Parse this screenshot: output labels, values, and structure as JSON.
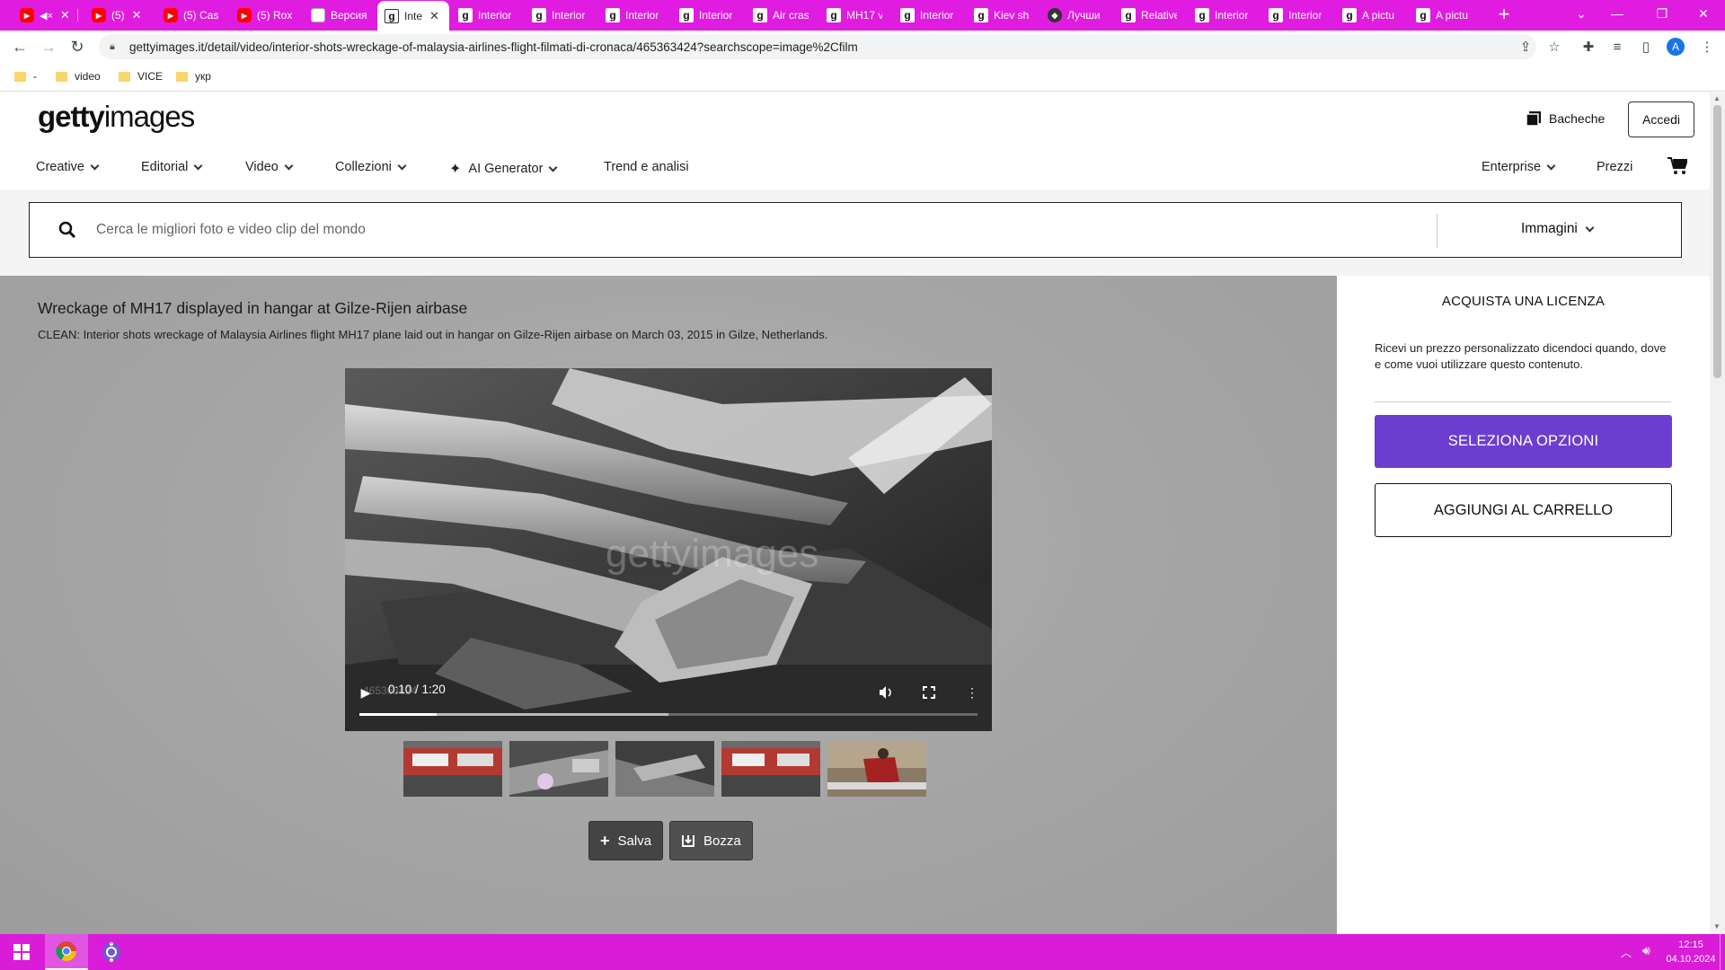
{
  "browser": {
    "tabs": [
      {
        "title": "",
        "icon": "youtube",
        "muted": true
      },
      {
        "title": "(5)",
        "icon": "youtube"
      },
      {
        "title": "(5) Cas",
        "icon": "youtube"
      },
      {
        "title": "(5) Rox",
        "icon": "youtube"
      },
      {
        "title": "Версия",
        "icon": "doc"
      },
      {
        "title": "Inte",
        "icon": "getty",
        "active": true
      },
      {
        "title": "Interior",
        "icon": "getty"
      },
      {
        "title": "Interior",
        "icon": "getty"
      },
      {
        "title": "Interior",
        "icon": "getty"
      },
      {
        "title": "Interior",
        "icon": "getty"
      },
      {
        "title": "Air cras",
        "icon": "getty"
      },
      {
        "title": "MH17 v",
        "icon": "getty"
      },
      {
        "title": "Interior",
        "icon": "getty"
      },
      {
        "title": "Kiev sh",
        "icon": "getty"
      },
      {
        "title": "Лучши",
        "icon": "cube"
      },
      {
        "title": "Relative",
        "icon": "getty"
      },
      {
        "title": "Interior",
        "icon": "getty"
      },
      {
        "title": "Interior",
        "icon": "getty"
      },
      {
        "title": "A pictu",
        "icon": "getty"
      },
      {
        "title": "A pictu",
        "icon": "getty"
      }
    ],
    "new_tab": "+",
    "url": "gettyimages.it/detail/video/interior-shots-wreckage-of-malaysia-airlines-flight-filmati-di-cronaca/465363424?searchscope=image%2Cfilm",
    "profile_initial": "A",
    "bookmarks": [
      {
        "label": "-"
      },
      {
        "label": "video"
      },
      {
        "label": "VICE"
      },
      {
        "label": "укр"
      }
    ]
  },
  "site": {
    "logo_bold": "getty",
    "logo_light": "images",
    "boards_label": "Bacheche",
    "login_label": "Accedi",
    "menu": [
      {
        "label": "Creative"
      },
      {
        "label": "Editorial"
      },
      {
        "label": "Video"
      },
      {
        "label": "Collezioni"
      },
      {
        "label": "AI Generator"
      },
      {
        "label": "Trend e analisi"
      }
    ],
    "enterprise_label": "Enterprise",
    "pricing_label": "Prezzi",
    "search_placeholder": "Cerca le migliori foto e video clip del mondo",
    "search_scope": "Immagini"
  },
  "asset": {
    "title": "Wreckage of MH17 displayed in hangar at Gilze-Rijen airbase",
    "caption": "CLEAN: Interior shots wreckage of Malaysia Airlines flight MH17 plane laid out in hangar on Gilze-Rijen airbase on March 03, 2015 in Gilze, Netherlands.",
    "watermark": "gettyimages",
    "video_id": "465363424",
    "time_display": "0:10 / 1:20",
    "progress_played": 0.125,
    "progress_buffered": 0.5,
    "save_label": "Salva",
    "draft_label": "Bozza"
  },
  "license": {
    "title": "ACQUISTA UNA LICENZA",
    "text": "Ricevi un prezzo personalizzato dicendoci quando, dove e come vuoi utilizzare questo contenuto.",
    "options_button": "SELEZIONA OPZIONI",
    "cart_button": "AGGIUNGI AL CARRELLO"
  },
  "taskbar": {
    "time": "12:15",
    "date": "04.10.2024"
  },
  "colors": {
    "tabstrip": "#e01ce0",
    "taskbar": "#d81cd8",
    "accent_purple": "#6c3ed0"
  }
}
